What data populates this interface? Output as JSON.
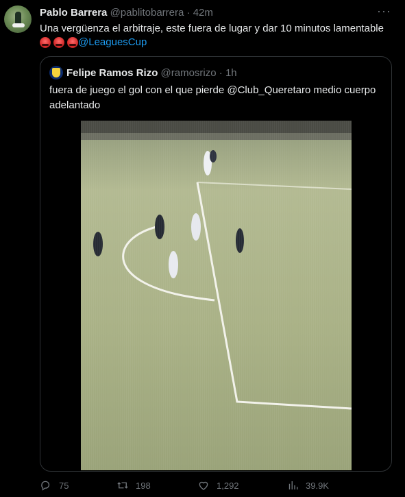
{
  "author": {
    "name": "Pablo Barrera",
    "handle": "@pablitobarrera",
    "separator": "·",
    "time": "42m"
  },
  "tweet": {
    "text": "Una vergüenza el arbitraje, este fuera de lugar y dar 10 minutos lamentable",
    "mention": "@LeaguesCup"
  },
  "more_label": "···",
  "quoted": {
    "name": "Felipe Ramos Rizo",
    "handle": "@ramosrizo",
    "separator": "·",
    "time": "1h",
    "text": "fuera de juego el gol con el que pierde @Club_Queretaro medio cuerpo adelantado"
  },
  "actions": {
    "replies": "75",
    "retweets": "198",
    "likes": "1,292",
    "views": "39.9K"
  },
  "colors": {
    "accent": "#1d9bf0",
    "muted": "#71767b",
    "pitch": "#a8b089"
  },
  "icons": [
    "reply-icon",
    "retweet-icon",
    "like-icon",
    "views-icon",
    "more-icon"
  ]
}
